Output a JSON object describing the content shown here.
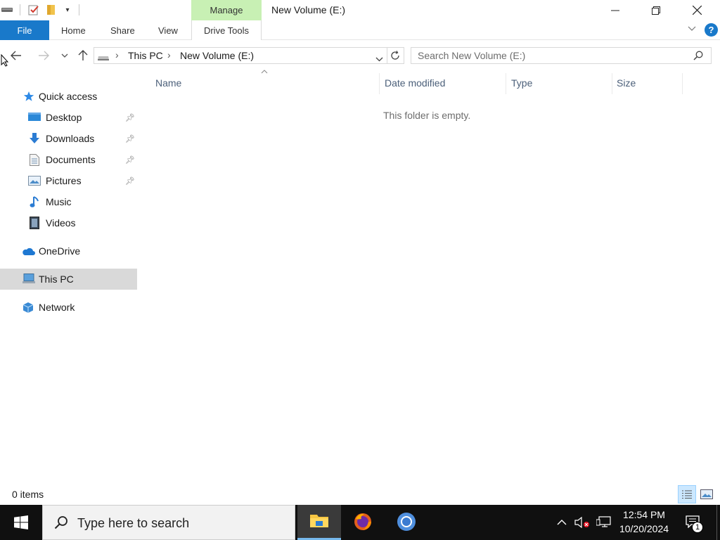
{
  "titlebar": {
    "manage_label": "Manage",
    "window_title": "New Volume (E:)"
  },
  "ribbon": {
    "file_label": "File",
    "tabs": [
      "Home",
      "Share",
      "View"
    ],
    "drive_tools_label": "Drive Tools",
    "help_label": "?"
  },
  "address": {
    "crumbs": [
      "This PC",
      "New Volume (E:)"
    ]
  },
  "search": {
    "placeholder": "Search New Volume (E:)"
  },
  "sidebar": {
    "items": [
      {
        "label": "Quick access",
        "icon": "star-icon"
      },
      {
        "label": "Desktop",
        "icon": "desktop-icon",
        "pinned": true
      },
      {
        "label": "Downloads",
        "icon": "download-icon",
        "pinned": true
      },
      {
        "label": "Documents",
        "icon": "document-icon",
        "pinned": true
      },
      {
        "label": "Pictures",
        "icon": "pictures-icon",
        "pinned": true
      },
      {
        "label": "Music",
        "icon": "music-icon"
      },
      {
        "label": "Videos",
        "icon": "videos-icon"
      },
      {
        "label": "OneDrive",
        "icon": "cloud-icon"
      },
      {
        "label": "This PC",
        "icon": "computer-icon",
        "selected": true
      },
      {
        "label": "Network",
        "icon": "network-icon"
      }
    ]
  },
  "content": {
    "columns": [
      "Name",
      "Date modified",
      "Type",
      "Size"
    ],
    "empty_message": "This folder is empty."
  },
  "status": {
    "item_count": "0 items"
  },
  "taskbar": {
    "search_text": "Type here to search",
    "time": "12:54 PM",
    "date": "10/20/2024",
    "notification_count": "1"
  },
  "colors": {
    "accent": "#1979ca",
    "manage_tab": "#c8f0b4",
    "selected_item": "#d9d9d9",
    "taskbar": "#101010"
  }
}
